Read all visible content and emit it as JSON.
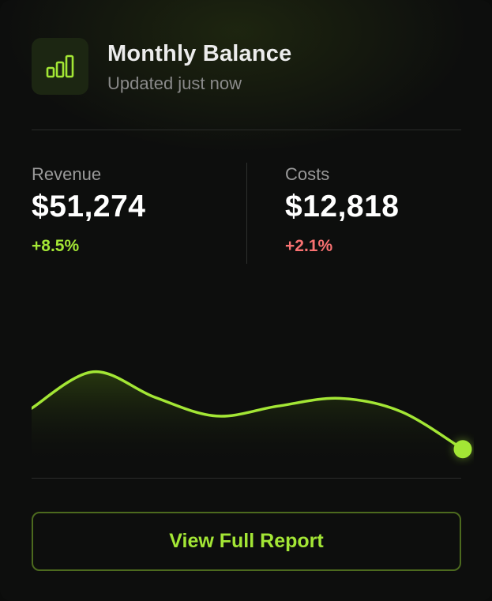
{
  "colors": {
    "accent": "#a3e635",
    "negative": "#f87171",
    "background": "#0d0e0d"
  },
  "header": {
    "icon": "bar-chart-icon",
    "title": "Monthly Balance",
    "subtitle": "Updated just now"
  },
  "stats": {
    "revenue": {
      "label": "Revenue",
      "value": "$51,274",
      "change": "+8.5%"
    },
    "costs": {
      "label": "Costs",
      "value": "$12,818",
      "change": "+2.1%"
    }
  },
  "chart_data": {
    "type": "area",
    "title": "",
    "xlabel": "",
    "ylabel": "",
    "grid": false,
    "series": [
      {
        "values": [
          0.45,
          0.78,
          0.55,
          0.38,
          0.47,
          0.54,
          0.42,
          0.08
        ]
      }
    ]
  },
  "actions": {
    "report_label": "View Full Report"
  }
}
